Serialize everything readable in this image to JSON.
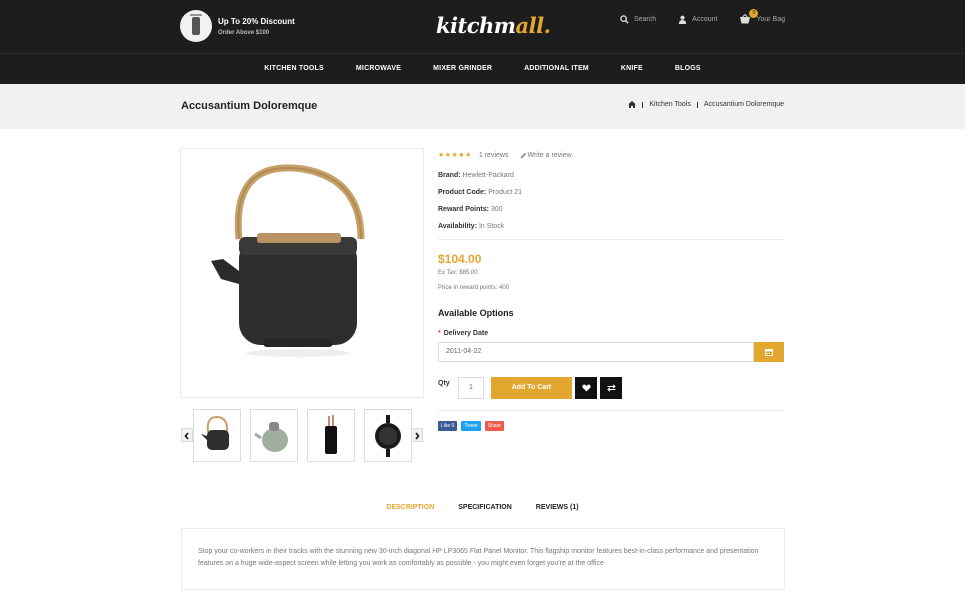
{
  "header": {
    "promo_title": "Up To 20% Discount",
    "promo_sub": "Order Above $100",
    "logo_main": "kitchm",
    "logo_accent": "all.",
    "search_label": "Search",
    "account_label": "Account",
    "bag_label": "Your Bag",
    "bag_count": "0"
  },
  "nav": {
    "items": [
      "KITCHEN TOOLS",
      "MICROWAVE",
      "MIXER GRINDER",
      "ADDITIONAL ITEM",
      "KNIFE",
      "BLOGS"
    ]
  },
  "breadcrumb": {
    "page_title": "Accusantium Doloremque",
    "items": [
      "Kitchen Tools",
      "Accusantium Doloremque"
    ]
  },
  "product": {
    "rating_stars": "★★★★★",
    "reviews": "1 reviews",
    "write_review": "Write a review",
    "specs": [
      {
        "label": "Brand:",
        "value": "Hewlett-Packard"
      },
      {
        "label": "Product Code:",
        "value": "Product 21"
      },
      {
        "label": "Reward Points:",
        "value": "300"
      },
      {
        "label": "Availability:",
        "value": "In Stock"
      }
    ],
    "price": "$104.00",
    "ex_tax": "Ex Tax: $85.00",
    "reward_price": "Price in reward points: 400",
    "options_title": "Available Options",
    "delivery_label": "Delivery Date",
    "delivery_value": "2011-04-22",
    "qty_label": "Qty",
    "qty_value": "1",
    "add_to_cart": "Add To Cart",
    "share": [
      "Like 0",
      "Tweet",
      "Share"
    ]
  },
  "tabs": [
    "DESCRIPTION",
    "SPECIFICATION",
    "REVIEWS (1)"
  ],
  "description": "Stop your co-workers in their tracks with the stunning new 30-inch diagonal HP LP3065 Flat Panel Monitor. This flagship monitor features best-in-class performance and presentation features on a huge wide-aspect screen while letting you work as comfortably as possible - you might even forget you're at the office",
  "colors": {
    "accent": "#e3a72f",
    "header_bg": "#1d1d1d",
    "band_bg": "#f1f1f1",
    "facebook": "#3b5998",
    "twitter": "#1da1f2",
    "share": "#ee5d4c"
  }
}
